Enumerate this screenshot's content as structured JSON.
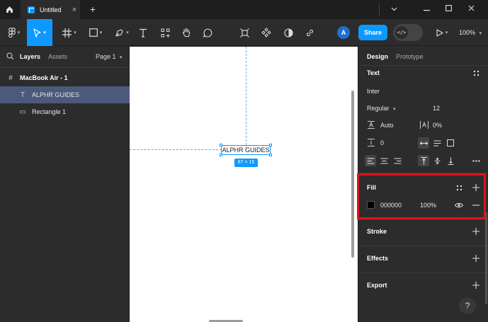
{
  "titlebar": {
    "tab_title": "Untitled",
    "tab_close": "×",
    "new_tab": "+",
    "minimize": "—",
    "maximize": "☐",
    "close": "✕",
    "collapse": "⌄"
  },
  "toolbar": {
    "avatar_initial": "A",
    "share_label": "Share",
    "zoom_label": "100%",
    "devmode_glyph": "</>"
  },
  "left_panel": {
    "layers_tab": "Layers",
    "assets_tab": "Assets",
    "page_selector": "Page 1",
    "layers": [
      {
        "name": "MacBook Air - 1",
        "icon": "frame-icon"
      },
      {
        "name": "ALPHR GUIDES",
        "icon": "text-icon"
      },
      {
        "name": "Rectangle 1",
        "icon": "rectangle-icon"
      }
    ]
  },
  "canvas": {
    "text_content": "ALPHR GUIDES",
    "dimensions": "87 × 15"
  },
  "right_panel": {
    "design_tab": "Design",
    "prototype_tab": "Prototype",
    "text_section": "Text",
    "font_family": "Inter",
    "font_weight": "Regular",
    "font_size": "12",
    "line_height": "Auto",
    "letter_spacing": "0%",
    "paragraph_spacing": "0",
    "fill_section": "Fill",
    "fill_hex": "000000",
    "fill_opacity": "100%",
    "stroke_section": "Stroke",
    "effects_section": "Effects",
    "export_section": "Export",
    "help": "?"
  },
  "colors": {
    "accent": "#0d99ff",
    "highlight": "#e0141e",
    "fill_swatch": "#000000"
  }
}
